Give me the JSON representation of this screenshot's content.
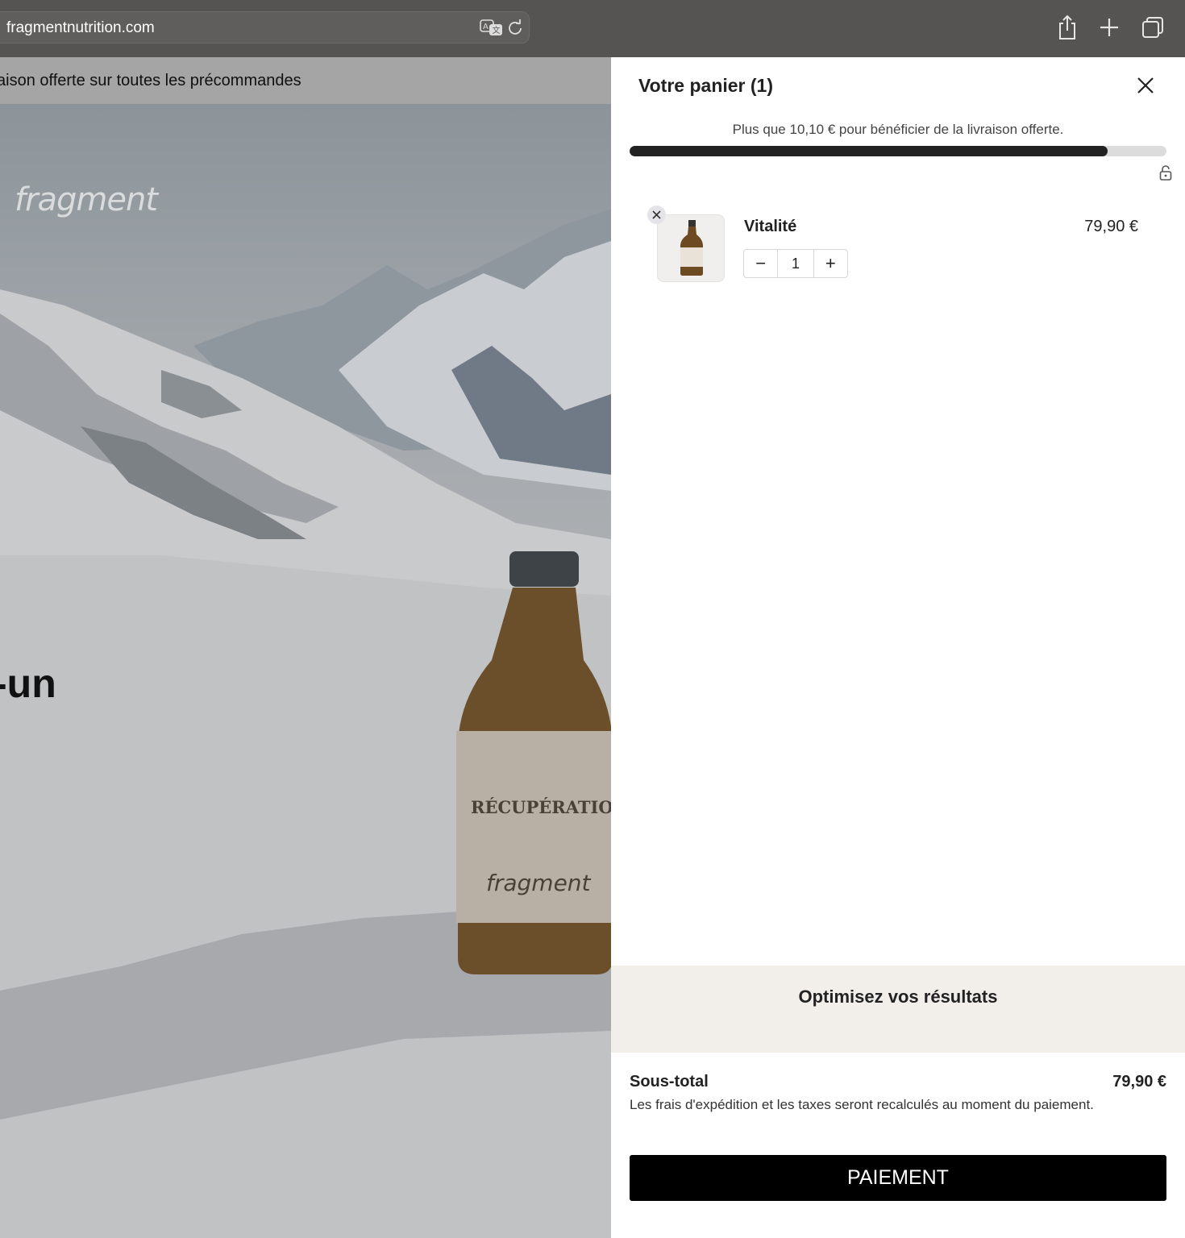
{
  "browser": {
    "url": "fragmentnutrition.com",
    "icons": [
      "translate-icon",
      "reload-icon",
      "share-icon",
      "new-tab-icon",
      "tabs-overview-icon"
    ]
  },
  "page": {
    "announcement": "aison offerte sur toutes les précommandes",
    "logo": "fragment",
    "hero_heading": "-un",
    "bottle_label_title": "RÉCUPÉRATION",
    "bottle_label_brand": "fragment"
  },
  "cart": {
    "title": "Votre panier (1)",
    "shipping_message": "Plus que 10,10 € pour bénéficier de la livraison offerte.",
    "shipping_progress": 0.89,
    "items": [
      {
        "name": "Vitalité",
        "price": "79,90 €",
        "quantity": "1"
      }
    ],
    "qty_minus": "−",
    "qty_plus": "+",
    "upsell_title": "Optimisez vos résultats",
    "subtotal_label": "Sous-total",
    "subtotal_value": "79,90 €",
    "tax_note": "Les frais d'expédition et les taxes seront recalculés au moment du paiement.",
    "checkout_label": "PAIEMENT"
  },
  "colors": {
    "chrome": "#555452",
    "progress_fill": "#222222",
    "checkout_bg": "#000000",
    "upsell_bg": "#f2efeb"
  }
}
